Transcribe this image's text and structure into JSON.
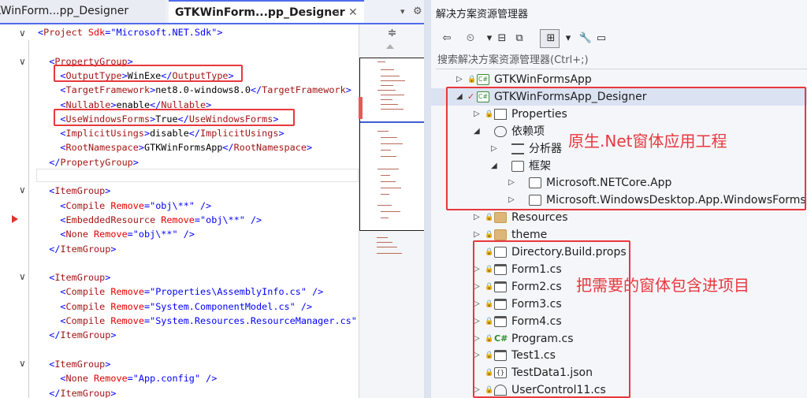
{
  "editor": {
    "tabs": [
      {
        "label": "KWinForm...pp_Designer"
      },
      {
        "label": "GTKWinForm...pp_Designer",
        "pin": "⊣",
        "close": "✕"
      }
    ],
    "tab_dropdown": "▾",
    "tab_settings": "⚙",
    "split_glyph": "≑",
    "lines": [
      {
        "parts": [
          [
            "p",
            "<"
          ],
          [
            "t",
            "Project"
          ],
          [
            "a",
            " Sdk"
          ],
          [
            "p",
            "=\""
          ],
          [
            "v",
            "Microsoft.NET.Sdk"
          ],
          [
            "p",
            "\">"
          ]
        ]
      },
      {
        "parts": []
      },
      {
        "parts": [
          [
            "x",
            "  "
          ],
          [
            "p",
            "<"
          ],
          [
            "t",
            "PropertyGroup"
          ],
          [
            "p",
            ">"
          ]
        ]
      },
      {
        "parts": [
          [
            "x",
            "    "
          ],
          [
            "p",
            "<"
          ],
          [
            "t",
            "OutputType"
          ],
          [
            "p",
            ">"
          ],
          [
            "x",
            "WinExe"
          ],
          [
            "p",
            "</"
          ],
          [
            "t",
            "OutputType"
          ],
          [
            "p",
            ">"
          ]
        ]
      },
      {
        "parts": [
          [
            "x",
            "    "
          ],
          [
            "p",
            "<"
          ],
          [
            "t",
            "TargetFramework"
          ],
          [
            "p",
            ">"
          ],
          [
            "x",
            "net8.0-windows8.0"
          ],
          [
            "p",
            "</"
          ],
          [
            "t",
            "TargetFramework"
          ],
          [
            "p",
            ">"
          ]
        ]
      },
      {
        "parts": [
          [
            "x",
            "    "
          ],
          [
            "p",
            "<"
          ],
          [
            "t",
            "Nullable"
          ],
          [
            "p",
            ">"
          ],
          [
            "x",
            "enable"
          ],
          [
            "p",
            "</"
          ],
          [
            "t",
            "Nullable"
          ],
          [
            "p",
            ">"
          ]
        ]
      },
      {
        "parts": [
          [
            "x",
            "    "
          ],
          [
            "p",
            "<"
          ],
          [
            "t",
            "UseWindowsForms"
          ],
          [
            "p",
            ">"
          ],
          [
            "x",
            "True"
          ],
          [
            "p",
            "</"
          ],
          [
            "t",
            "UseWindowsForms"
          ],
          [
            "p",
            ">"
          ]
        ]
      },
      {
        "parts": [
          [
            "x",
            "    "
          ],
          [
            "p",
            "<"
          ],
          [
            "t",
            "ImplicitUsings"
          ],
          [
            "p",
            ">"
          ],
          [
            "x",
            "disable"
          ],
          [
            "p",
            "</"
          ],
          [
            "t",
            "ImplicitUsings"
          ],
          [
            "p",
            ">"
          ]
        ]
      },
      {
        "parts": [
          [
            "x",
            "    "
          ],
          [
            "p",
            "<"
          ],
          [
            "t",
            "RootNamespace"
          ],
          [
            "p",
            ">"
          ],
          [
            "x",
            "GTKWinFormsApp"
          ],
          [
            "p",
            "</"
          ],
          [
            "t",
            "RootNamespace"
          ],
          [
            "p",
            ">"
          ]
        ]
      },
      {
        "parts": [
          [
            "x",
            "  "
          ],
          [
            "p",
            "</"
          ],
          [
            "t",
            "PropertyGroup"
          ],
          [
            "p",
            ">"
          ]
        ]
      },
      {
        "parts": []
      },
      {
        "parts": [
          [
            "x",
            "  "
          ],
          [
            "p",
            "<"
          ],
          [
            "t",
            "ItemGroup"
          ],
          [
            "p",
            ">"
          ]
        ]
      },
      {
        "parts": [
          [
            "x",
            "    "
          ],
          [
            "p",
            "<"
          ],
          [
            "t",
            "Compile"
          ],
          [
            "a",
            " Remove"
          ],
          [
            "p",
            "=\""
          ],
          [
            "v",
            "obj\\**"
          ],
          [
            "p",
            "\""
          ],
          [
            "p",
            " />"
          ]
        ]
      },
      {
        "parts": [
          [
            "x",
            "    "
          ],
          [
            "p",
            "<"
          ],
          [
            "t",
            "EmbeddedResource"
          ],
          [
            "a",
            " Remove"
          ],
          [
            "p",
            "=\""
          ],
          [
            "v",
            "obj\\**"
          ],
          [
            "p",
            "\""
          ],
          [
            "p",
            " />"
          ]
        ]
      },
      {
        "parts": [
          [
            "x",
            "    "
          ],
          [
            "p",
            "<"
          ],
          [
            "t",
            "None"
          ],
          [
            "a",
            " Remove"
          ],
          [
            "p",
            "=\""
          ],
          [
            "v",
            "obj\\**"
          ],
          [
            "p",
            "\""
          ],
          [
            "p",
            " />"
          ]
        ]
      },
      {
        "parts": [
          [
            "x",
            "  "
          ],
          [
            "p",
            "</"
          ],
          [
            "t",
            "ItemGroup"
          ],
          [
            "p",
            ">"
          ]
        ]
      },
      {
        "parts": []
      },
      {
        "parts": [
          [
            "x",
            "  "
          ],
          [
            "p",
            "<"
          ],
          [
            "t",
            "ItemGroup"
          ],
          [
            "p",
            ">"
          ]
        ]
      },
      {
        "parts": [
          [
            "x",
            "    "
          ],
          [
            "p",
            "<"
          ],
          [
            "t",
            "Compile"
          ],
          [
            "a",
            " Remove"
          ],
          [
            "p",
            "=\""
          ],
          [
            "v",
            "Properties\\AssemblyInfo.cs"
          ],
          [
            "p",
            "\""
          ],
          [
            "p",
            " />"
          ]
        ]
      },
      {
        "parts": [
          [
            "x",
            "    "
          ],
          [
            "p",
            "<"
          ],
          [
            "t",
            "Compile"
          ],
          [
            "a",
            " Remove"
          ],
          [
            "p",
            "=\""
          ],
          [
            "v",
            "System.ComponentModel.cs"
          ],
          [
            "p",
            "\""
          ],
          [
            "p",
            " />"
          ]
        ]
      },
      {
        "parts": [
          [
            "x",
            "    "
          ],
          [
            "p",
            "<"
          ],
          [
            "t",
            "Compile"
          ],
          [
            "a",
            " Remove"
          ],
          [
            "p",
            "=\""
          ],
          [
            "v",
            "System.Resources.ResourceManager.cs"
          ],
          [
            "p",
            "\""
          ],
          [
            "p",
            " />"
          ]
        ]
      },
      {
        "parts": [
          [
            "x",
            "  "
          ],
          [
            "p",
            "</"
          ],
          [
            "t",
            "ItemGroup"
          ],
          [
            "p",
            ">"
          ]
        ]
      },
      {
        "parts": []
      },
      {
        "parts": [
          [
            "x",
            "  "
          ],
          [
            "p",
            "<"
          ],
          [
            "t",
            "ItemGroup"
          ],
          [
            "p",
            ">"
          ]
        ]
      },
      {
        "parts": [
          [
            "x",
            "    "
          ],
          [
            "p",
            "<"
          ],
          [
            "t",
            "None"
          ],
          [
            "a",
            " Remove"
          ],
          [
            "p",
            "=\""
          ],
          [
            "v",
            "App.config"
          ],
          [
            "p",
            "\""
          ],
          [
            "p",
            " />"
          ]
        ]
      },
      {
        "parts": [
          [
            "x",
            "  "
          ],
          [
            "p",
            "</"
          ],
          [
            "t",
            "ItemGroup"
          ],
          [
            "p",
            ">"
          ]
        ]
      }
    ]
  },
  "solution_explorer": {
    "title": "解决方案资源管理器",
    "search_placeholder": "搜索解决方案资源管理器(Ctrl+;)",
    "toolbar": [
      "⇦",
      "⏲",
      "▾",
      "⊟",
      "⧉",
      "⊞",
      "▾",
      "🔧",
      "▭"
    ],
    "items": [
      {
        "label": "GTKWinFormsApp",
        "expander": "▷",
        "icon": "csharp-project",
        "lock": true,
        "level": 0
      },
      {
        "label": "GTKWinFormsApp_Designer",
        "expander": "◢",
        "icon": "csharp-project",
        "lock": false,
        "check": true,
        "level": 0,
        "selected": true
      },
      {
        "label": "Properties",
        "expander": "▷",
        "icon": "properties",
        "lock": true,
        "level": 1
      },
      {
        "label": "依赖项",
        "expander": "◢",
        "icon": "dependencies",
        "lock": false,
        "level": 1
      },
      {
        "label": "分析器",
        "expander": "▷",
        "icon": "analyzer",
        "lock": false,
        "level": 2
      },
      {
        "label": "框架",
        "expander": "◢",
        "icon": "framework",
        "lock": false,
        "level": 2
      },
      {
        "label": "Microsoft.NETCore.App",
        "expander": "▷",
        "icon": "framework",
        "lock": false,
        "level": 3
      },
      {
        "label": "Microsoft.WindowsDesktop.App.WindowsForms",
        "expander": "▷",
        "icon": "framework",
        "lock": false,
        "level": 3
      },
      {
        "label": "Resources",
        "expander": "▷",
        "icon": "folder",
        "lock": true,
        "level": 1
      },
      {
        "label": "theme",
        "expander": "▷",
        "icon": "folder",
        "lock": true,
        "level": 1
      },
      {
        "label": "Directory.Build.props",
        "expander": "",
        "icon": "props",
        "lock": true,
        "level": 1
      },
      {
        "label": "Form1.cs",
        "expander": "▷",
        "icon": "form",
        "lock": true,
        "level": 1
      },
      {
        "label": "Form2.cs",
        "expander": "▷",
        "icon": "form",
        "lock": true,
        "level": 1
      },
      {
        "label": "Form3.cs",
        "expander": "▷",
        "icon": "form",
        "lock": true,
        "level": 1
      },
      {
        "label": "Form4.cs",
        "expander": "▷",
        "icon": "form",
        "lock": true,
        "level": 1
      },
      {
        "label": "Program.cs",
        "expander": "▷",
        "icon": "csharp-file",
        "lock": true,
        "level": 1
      },
      {
        "label": "Test1.cs",
        "expander": "▷",
        "icon": "form",
        "lock": true,
        "level": 1
      },
      {
        "label": "TestData1.json",
        "expander": "",
        "icon": "json",
        "lock": true,
        "level": 1
      },
      {
        "label": "UserControl11.cs",
        "expander": "▷",
        "icon": "usercontrol",
        "lock": true,
        "level": 1
      }
    ]
  },
  "annotations": {
    "native_project": "原生.Net窗体应用工程",
    "include_forms": "把需要的窗体包含进项目"
  },
  "colors": {
    "accent": "#4f6bed",
    "annotation_red": "#e8383d",
    "xml_tag": "#a31515",
    "xml_attr": "#e50000",
    "xml_value": "#0000ff"
  }
}
